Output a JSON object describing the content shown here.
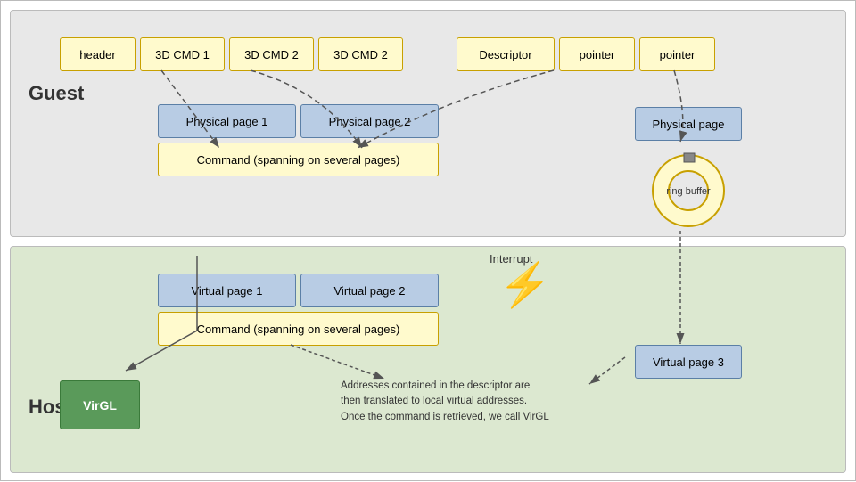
{
  "labels": {
    "guest": "Guest",
    "host": "Host",
    "header": "header",
    "cmd1": "3D  CMD 1",
    "cmd2a": "3D  CMD 2",
    "cmd2b": "3D  CMD 2",
    "descriptor": "Descriptor",
    "pointer1": "pointer",
    "pointer2": "pointer",
    "physical_page_1": "Physical page 1",
    "physical_page_2": "Physical page 2",
    "command_guest": "Command (spanning on several pages)",
    "physical_page_ring": "Physical page",
    "ring_buffer": "ring buffer",
    "virtual_page_1": "Virtual page 1",
    "virtual_page_2": "Virtual page 2",
    "command_host": "Command (spanning on several pages)",
    "virtual_page_3": "Virtual page 3",
    "virgl": "VirGL",
    "interrupt": "Interrupt",
    "address_note": "Addresses contained in the descriptor are\nthen translated to local virtual addresses.\nOnce the command is retrieved, we call VirGL"
  },
  "colors": {
    "yellow_bg": "#fffacd",
    "yellow_border": "#c8a000",
    "blue_bg": "#b8cce4",
    "blue_border": "#5b7fa6",
    "green_bg": "#5a9a5a",
    "guest_bg": "#e8e8e8",
    "host_bg": "#dce8d0"
  }
}
